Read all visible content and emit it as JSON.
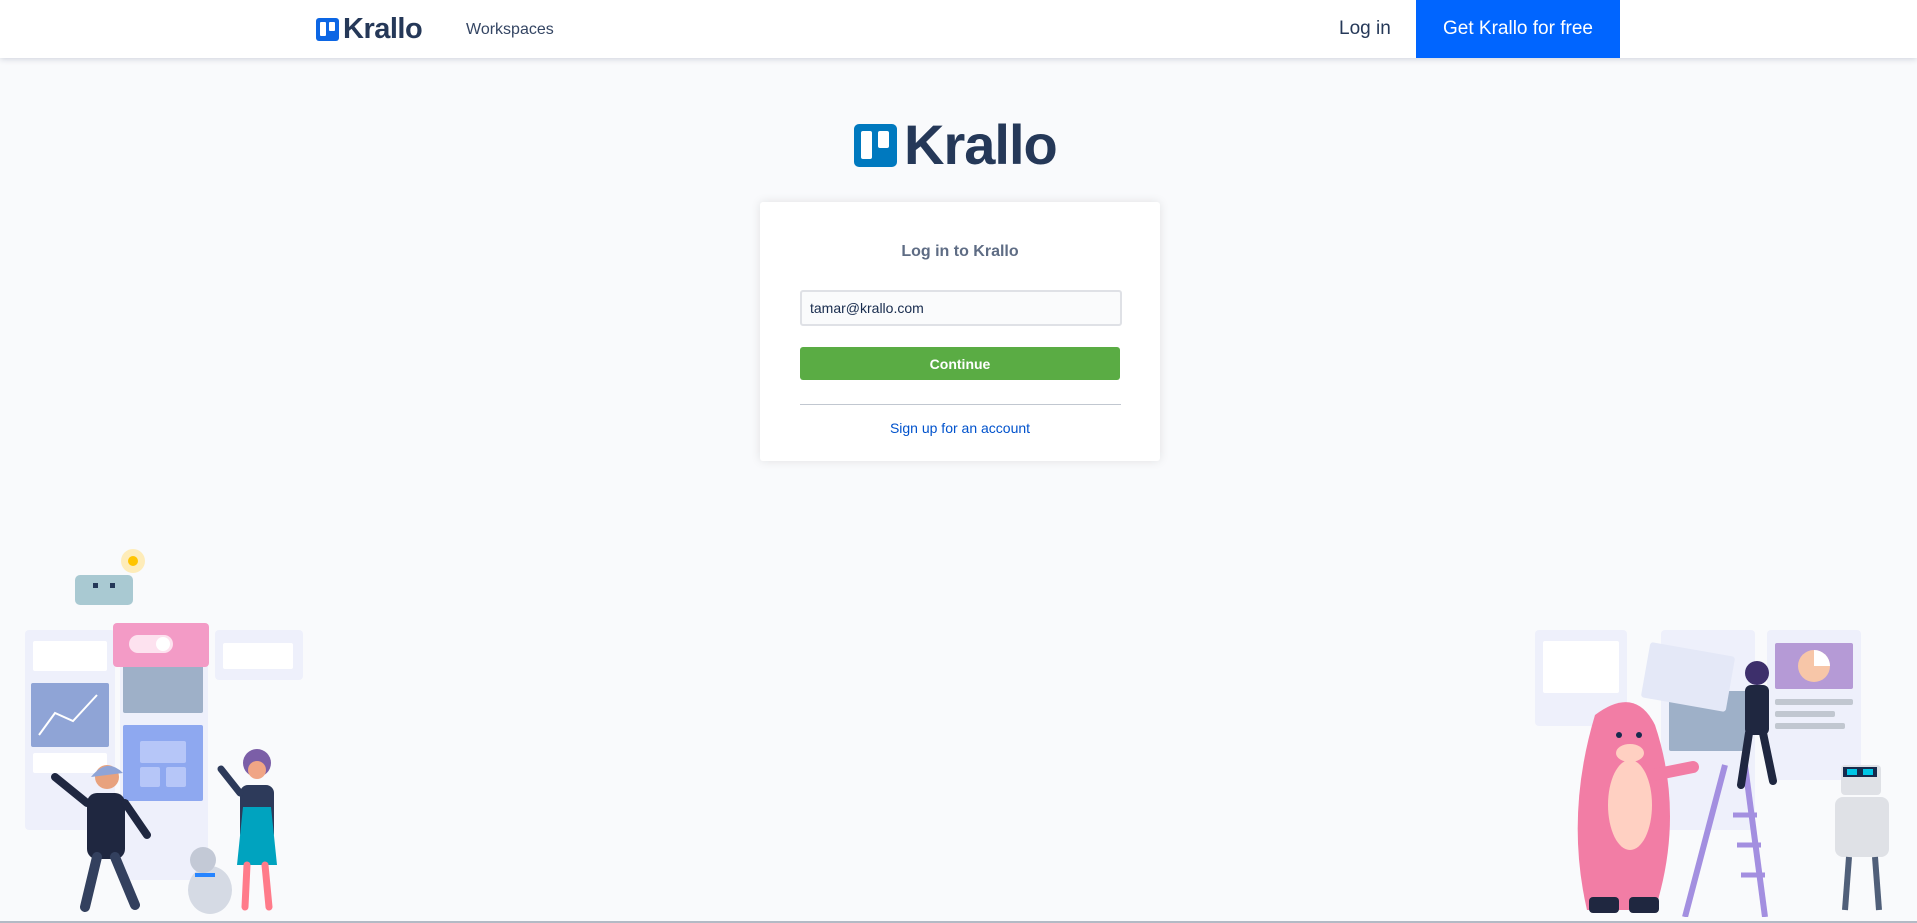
{
  "nav": {
    "brand": "Krallo",
    "workspaces_label": "Workspaces",
    "login_label": "Log in",
    "cta_label": "Get Krallo for free"
  },
  "hero": {
    "brand": "Krallo"
  },
  "login_card": {
    "title": "Log in to Krallo",
    "email_value": "tamar@krallo.com",
    "continue_label": "Continue",
    "signup_label": "Sign up for an account"
  },
  "icons": {
    "logo": "krallo-board-icon",
    "left_illustration": "team-with-boards-illustration",
    "right_illustration": "creatures-with-boards-illustration"
  },
  "colors": {
    "primary_blue": "#0065ff",
    "continue_green": "#5aac44",
    "link_blue": "#0052cc",
    "brand_navy": "#253858"
  }
}
